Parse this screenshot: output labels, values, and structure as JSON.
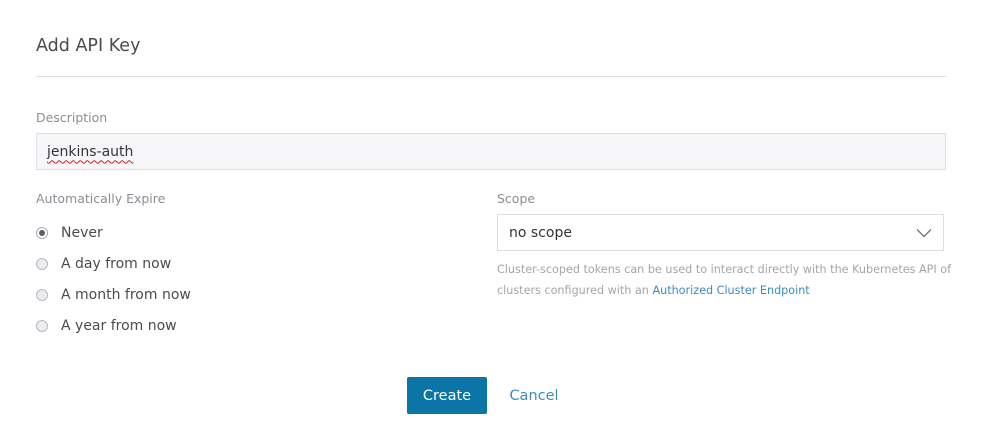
{
  "header": {
    "title": "Add API Key"
  },
  "description": {
    "label": "Description",
    "value": "jenkins-auth"
  },
  "expire": {
    "label": "Automatically Expire",
    "options": [
      {
        "label": "Never",
        "checked": true
      },
      {
        "label": "A day from now",
        "checked": false
      },
      {
        "label": "A month from now",
        "checked": false
      },
      {
        "label": "A year from now",
        "checked": false
      }
    ]
  },
  "scope": {
    "label": "Scope",
    "selected": "no scope",
    "help_text": "Cluster-scoped tokens can be used to interact directly with the Kubernetes API of clusters configured with an ",
    "help_link": "Authorized Cluster Endpoint"
  },
  "actions": {
    "create_label": "Create",
    "cancel_label": "Cancel"
  },
  "colors": {
    "primary": "#0c75a7",
    "link": "#3d8bbf",
    "border": "#dcdee7",
    "input_bg": "#f7f7f9"
  },
  "icons": {
    "select_caret": "chevron-down-icon"
  }
}
